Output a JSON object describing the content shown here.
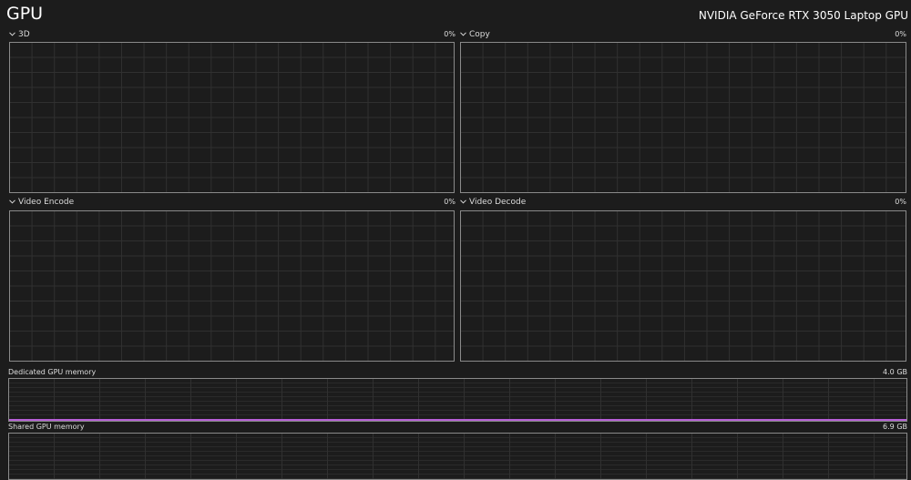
{
  "header": {
    "title": "GPU",
    "device_name": "NVIDIA GeForce RTX 3050 Laptop GPU"
  },
  "engines": [
    {
      "label": "3D",
      "value": "0%"
    },
    {
      "label": "Copy",
      "value": "0%"
    },
    {
      "label": "Video Encode",
      "value": "0%"
    },
    {
      "label": "Video Decode",
      "value": "0%"
    }
  ],
  "memory": {
    "dedicated": {
      "label": "Dedicated GPU memory",
      "max": "4.0 GB",
      "usage_fraction": 0.0
    },
    "shared": {
      "label": "Shared GPU memory",
      "max": "6.9 GB",
      "usage_fraction": 0.0
    }
  },
  "colors": {
    "background": "#1c1c1c",
    "grid_border": "#8a8a8a",
    "grid_line": "#303030",
    "dedicated_memory_line": "#b65fd6"
  },
  "icons": {
    "collapse": "chevron-down-icon"
  }
}
